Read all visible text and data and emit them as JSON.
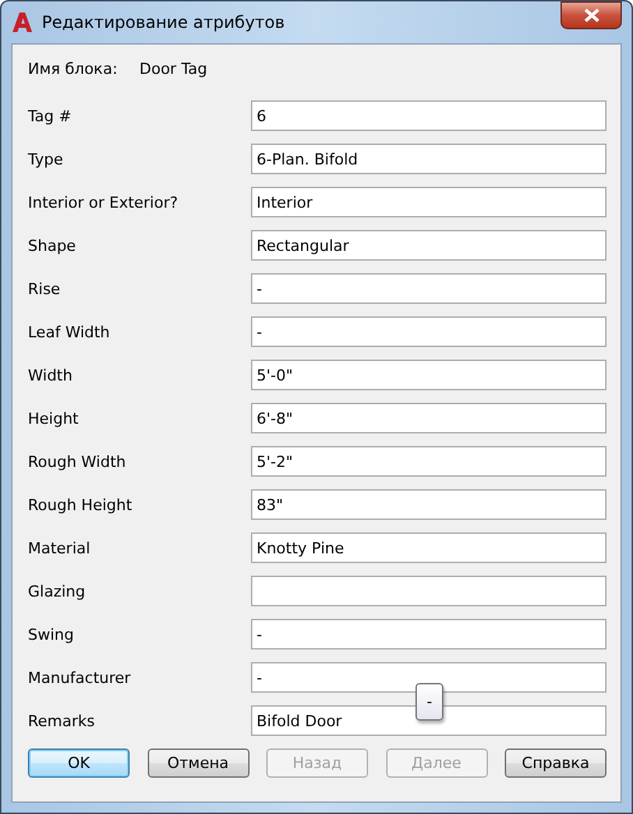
{
  "window": {
    "title": "Редактирование атрибутов"
  },
  "block": {
    "label": "Имя блока:",
    "value": "Door Tag"
  },
  "attributes": [
    {
      "label": "Tag #",
      "value": "6"
    },
    {
      "label": "Type",
      "value": "6-Plan. Bifold"
    },
    {
      "label": "Interior or Exterior?",
      "value": "Interior"
    },
    {
      "label": "Shape",
      "value": "Rectangular"
    },
    {
      "label": "Rise",
      "value": "-"
    },
    {
      "label": "Leaf Width",
      "value": "-"
    },
    {
      "label": "Width",
      "value": "5'-0\""
    },
    {
      "label": "Height",
      "value": "6'-8\""
    },
    {
      "label": "Rough Width",
      "value": "5'-2\""
    },
    {
      "label": "Rough Height",
      "value": "83\""
    },
    {
      "label": "Material",
      "value": "Knotty Pine"
    },
    {
      "label": "Glazing"
    },
    {
      "label": "Swing",
      "value": "-"
    },
    {
      "label": "Manufacturer",
      "value": "-"
    },
    {
      "label": "Remarks",
      "value": "Bifold Door"
    }
  ],
  "tooltip": {
    "text": "-"
  },
  "buttons": [
    {
      "label": "OK",
      "disabled": false,
      "default": true
    },
    {
      "label": "Отмена",
      "disabled": false,
      "default": false
    },
    {
      "label": "Назад",
      "disabled": true,
      "default": false
    },
    {
      "label": "Далее",
      "disabled": true,
      "default": false
    },
    {
      "label": "Справка",
      "disabled": false,
      "default": false
    }
  ]
}
